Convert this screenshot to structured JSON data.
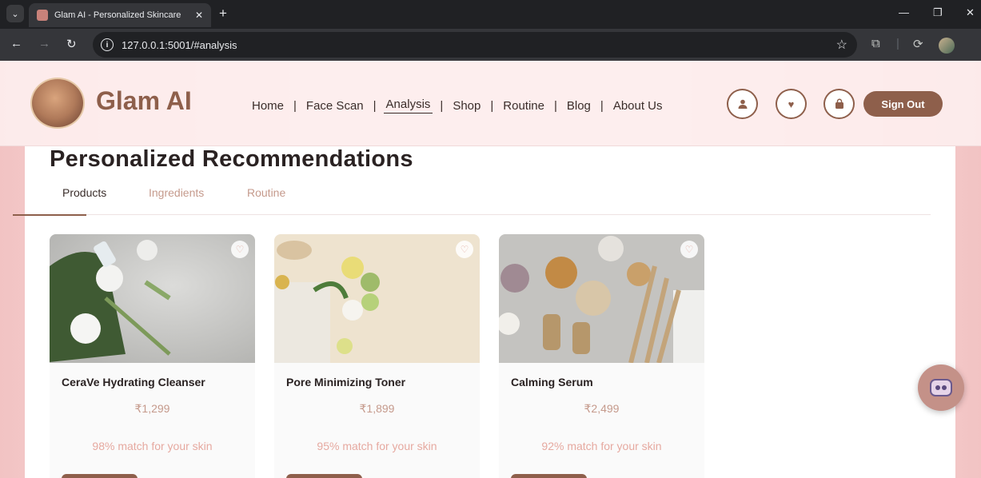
{
  "browser": {
    "tab_title": "Glam AI - Personalized Skincare",
    "tab_close": "✕",
    "new_tab": "+",
    "url": "127.0.0.1:5001/#analysis"
  },
  "header": {
    "brand": "Glam AI",
    "nav": [
      "Home",
      "Face Scan",
      "Analysis",
      "Shop",
      "Routine",
      "Blog",
      "About Us"
    ],
    "active_nav": "Analysis",
    "sign_out": "Sign Out"
  },
  "main": {
    "heading": "Personalized Recommendations",
    "tabs": [
      "Products",
      "Ingredients",
      "Routine"
    ],
    "active_tab": "Products",
    "products": [
      {
        "name": "CeraVe Hydrating Cleanser",
        "price": "₹1,299",
        "match": "98% match for your skin"
      },
      {
        "name": "Pore Minimizing Toner",
        "price": "₹1,899",
        "match": "95% match for your skin"
      },
      {
        "name": "Calming Serum",
        "price": "₹2,499",
        "match": "92% match for your skin"
      }
    ]
  },
  "icons": [
    "user-icon",
    "heart-icon",
    "bag-icon",
    "chatbot-icon"
  ],
  "colors": {
    "brand": "#8e5f4b",
    "accent": "#c59a8c",
    "match": "#e6a9a0"
  }
}
